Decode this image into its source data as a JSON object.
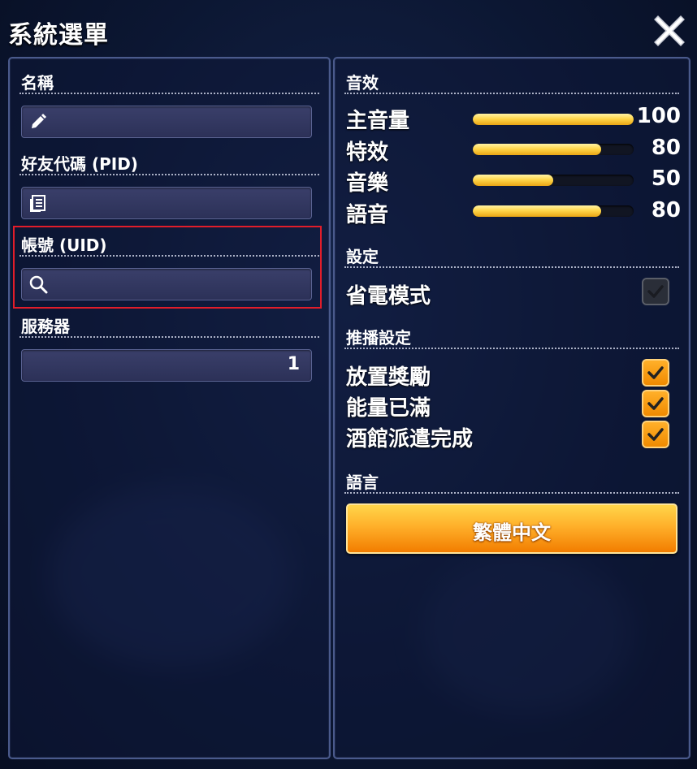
{
  "header": {
    "title": "系統選單"
  },
  "left": {
    "name": {
      "label": "名稱",
      "value": ""
    },
    "pid": {
      "label": "好友代碼 (PID)",
      "value": ""
    },
    "uid": {
      "label": "帳號 (UID)",
      "value": ""
    },
    "server": {
      "label": "服務器",
      "value": "1"
    }
  },
  "sound": {
    "label": "音效",
    "items": [
      {
        "label": "主音量",
        "value": 100
      },
      {
        "label": "特效",
        "value": 80
      },
      {
        "label": "音樂",
        "value": 50
      },
      {
        "label": "語音",
        "value": 80
      }
    ]
  },
  "settings": {
    "label": "設定",
    "power_saving": {
      "label": "省電模式",
      "checked": false
    }
  },
  "push": {
    "label": "推播設定",
    "items": [
      {
        "label": "放置獎勵",
        "checked": true
      },
      {
        "label": "能量已滿",
        "checked": true
      },
      {
        "label": "酒館派遣完成",
        "checked": true
      }
    ]
  },
  "language": {
    "label": "語言",
    "button": "繁體中文"
  },
  "colors": {
    "accent": "#f08a00",
    "bar": "#ffd64a",
    "highlight": "#e11d2a",
    "panel_border": "#4a5a8c"
  }
}
